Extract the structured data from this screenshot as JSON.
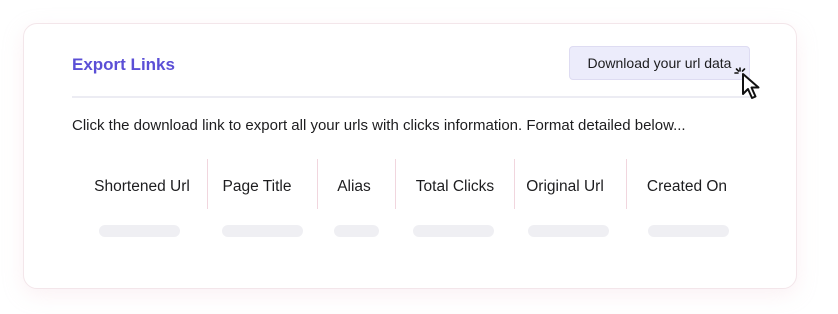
{
  "panel": {
    "title": "Export Links",
    "download_button_label": "Download your url data",
    "description": "Click the download link to export all your urls with clicks information. Format detailed below..."
  },
  "table": {
    "columns": [
      {
        "label": "Shortened Url"
      },
      {
        "label": "Page Title"
      },
      {
        "label": "Alias"
      },
      {
        "label": "Total Clicks"
      },
      {
        "label": "Original Url"
      },
      {
        "label": "Created On"
      }
    ],
    "loading": true
  },
  "cursor": {
    "icon": "pointer-cursor-icon"
  },
  "colors": {
    "accent": "#5b4fd6",
    "button_bg": "#ececfb",
    "divider": "#ececf3",
    "column_separator": "#f1d6de",
    "skeleton": "#efeff3"
  }
}
